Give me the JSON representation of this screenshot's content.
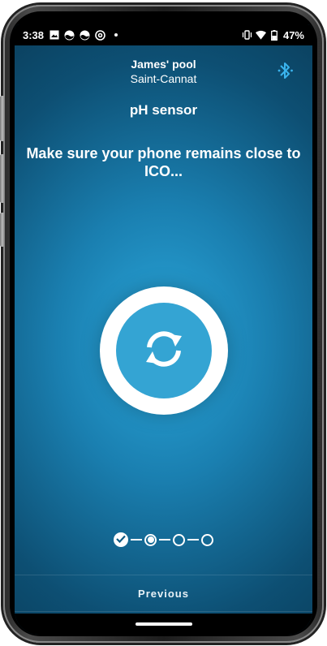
{
  "status_bar": {
    "time": "3:38",
    "notification_icons": [
      "image-icon",
      "pool-app-icon",
      "pool-app-icon",
      "at-sign-icon",
      "dot-icon"
    ],
    "status_icons": [
      "vibrate-icon",
      "wifi-icon",
      "battery-icon"
    ],
    "battery": "47%"
  },
  "header": {
    "pool_name": "James' pool",
    "pool_location": "Saint-Cannat",
    "bluetooth_icon": "bluetooth-icon",
    "bluetooth_color": "#3ab4ee"
  },
  "screen_title": "pH sensor",
  "instruction": "Make sure your phone remains close to ICO...",
  "sync": {
    "icon": "sync-icon",
    "ring_color": "#ffffff",
    "inner_color": "#34a4d3"
  },
  "stepper": {
    "total_steps": 4,
    "completed_steps": 1,
    "current_step": 2
  },
  "footer": {
    "previous_label": "Previous"
  }
}
